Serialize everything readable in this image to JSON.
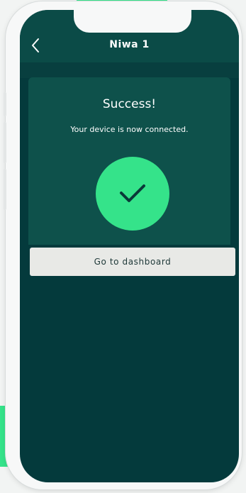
{
  "header": {
    "title": "Niwa 1",
    "back_icon": "chevron-left-icon"
  },
  "success": {
    "title": "Success!",
    "message": "Your device is now connected.",
    "status_icon": "checkmark-icon"
  },
  "actions": {
    "dashboard_label": "Go to dashboard"
  },
  "colors": {
    "background": "#043a3c",
    "header": "#0b4b47",
    "card": "#0e514b",
    "accent": "#35e38a",
    "button": "#e8e9e6",
    "button_text": "#1e3838"
  }
}
